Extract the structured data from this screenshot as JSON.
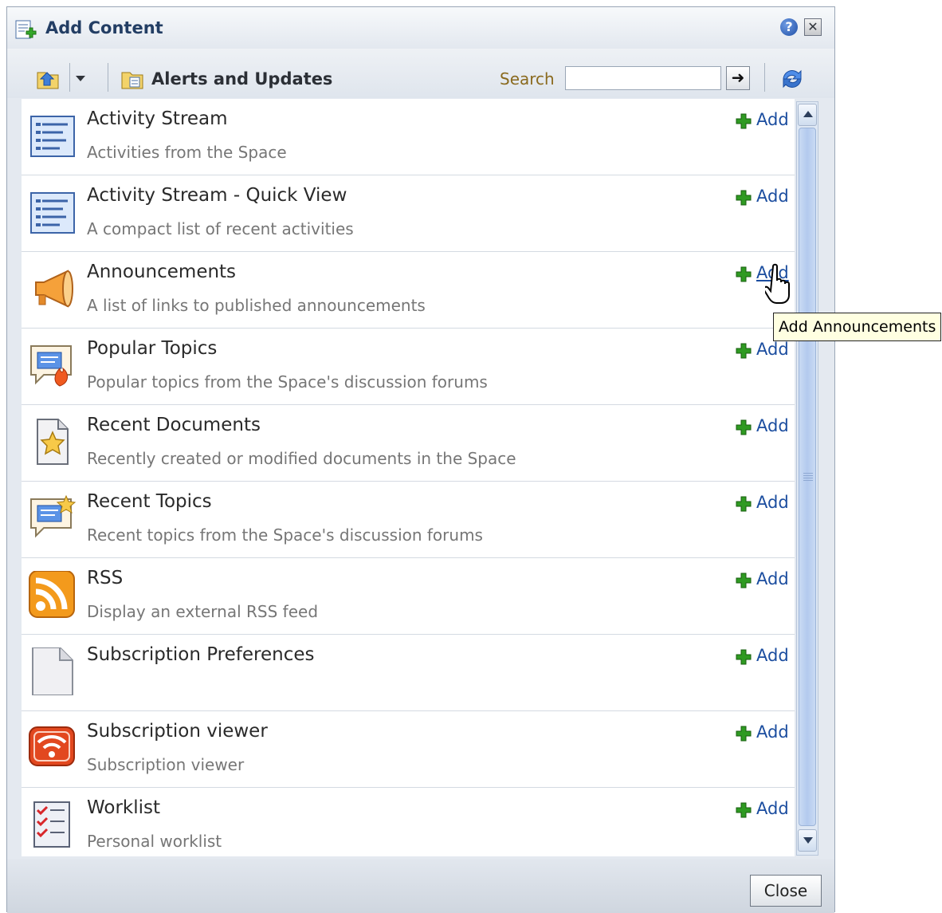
{
  "dialog": {
    "title": "Add Content",
    "help_icon": "?",
    "close_icon": "✕"
  },
  "toolbar": {
    "breadcrumb": "Alerts and Updates",
    "search_label": "Search",
    "search_value": "",
    "go_icon": "➜"
  },
  "items": [
    {
      "title": "Activity Stream",
      "desc": "Activities from the Space",
      "add": "Add",
      "icon": "activity-stream-icon"
    },
    {
      "title": "Activity Stream - Quick View",
      "desc": "A compact list of recent activities",
      "add": "Add",
      "icon": "activity-stream-icon"
    },
    {
      "title": "Announcements",
      "desc": "A list of links to published announcements",
      "add": "Add",
      "icon": "megaphone-icon"
    },
    {
      "title": "Popular Topics",
      "desc": "Popular topics from the Space's discussion forums",
      "add": "Add",
      "icon": "popular-topics-icon"
    },
    {
      "title": "Recent Documents",
      "desc": "Recently created or modified documents in the Space",
      "add": "Add",
      "icon": "recent-documents-icon"
    },
    {
      "title": "Recent Topics",
      "desc": "Recent topics from the Space's discussion forums",
      "add": "Add",
      "icon": "recent-topics-icon"
    },
    {
      "title": "RSS",
      "desc": "Display an external RSS feed",
      "add": "Add",
      "icon": "rss-icon"
    },
    {
      "title": "Subscription Preferences",
      "desc": "",
      "add": "Add",
      "icon": "blank-document-icon"
    },
    {
      "title": "Subscription viewer",
      "desc": "Subscription viewer",
      "add": "Add",
      "icon": "subscription-viewer-icon"
    },
    {
      "title": "Worklist",
      "desc": "Personal worklist",
      "add": "Add",
      "icon": "worklist-icon"
    }
  ],
  "tooltip": "Add Announcements",
  "footer": {
    "close_label": "Close"
  },
  "colors": {
    "link": "#1b4d9f",
    "title_text": "#233e64",
    "plus_green": "#2f9a22"
  }
}
